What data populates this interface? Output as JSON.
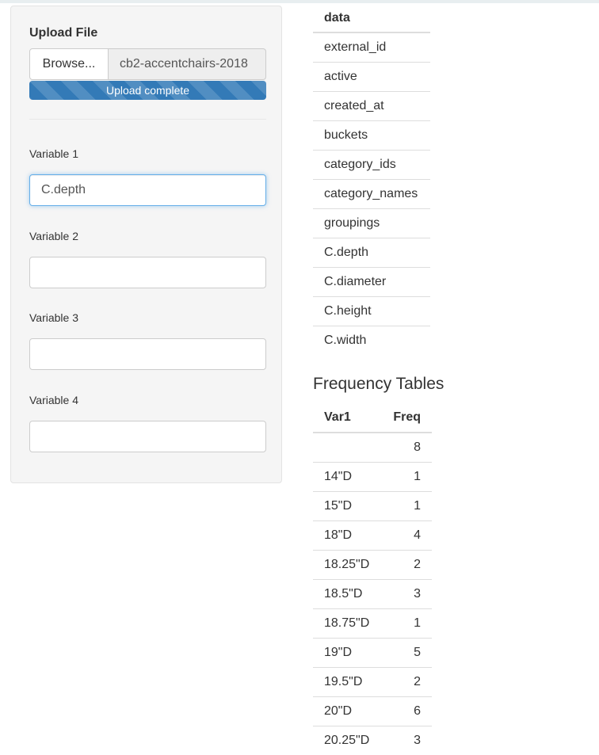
{
  "sidebar": {
    "upload_label": "Upload File",
    "browse_label": "Browse...",
    "file_name": "cb2-accentchairs-2018",
    "progress_text": "Upload complete",
    "progress_fraction": 1.0,
    "variables": [
      {
        "label": "Variable 1",
        "value": "C.depth"
      },
      {
        "label": "Variable 2",
        "value": ""
      },
      {
        "label": "Variable 3",
        "value": ""
      },
      {
        "label": "Variable 4",
        "value": ""
      }
    ]
  },
  "data_table": {
    "header": "data",
    "rows": [
      "external_id",
      "active",
      "created_at",
      "buckets",
      "category_ids",
      "category_names",
      "groupings",
      "C.depth",
      "C.diameter",
      "C.height",
      "C.width"
    ]
  },
  "frequency": {
    "title": "Frequency Tables",
    "headers": [
      "Var1",
      "Freq"
    ],
    "rows": [
      [
        "",
        "8"
      ],
      [
        "14\"D",
        "1"
      ],
      [
        "15\"D",
        "1"
      ],
      [
        "18\"D",
        "4"
      ],
      [
        "18.25\"D",
        "2"
      ],
      [
        "18.5\"D",
        "3"
      ],
      [
        "18.75\"D",
        "1"
      ],
      [
        "19\"D",
        "5"
      ],
      [
        "19.5\"D",
        "2"
      ],
      [
        "20\"D",
        "6"
      ],
      [
        "20.25\"D",
        "3"
      ]
    ]
  }
}
